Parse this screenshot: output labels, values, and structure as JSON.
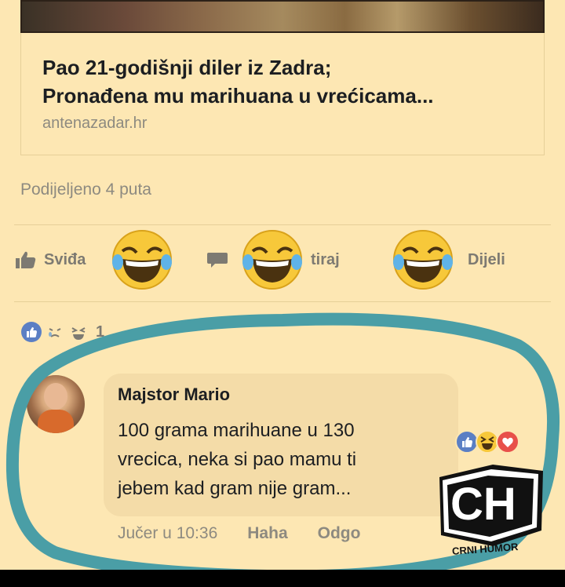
{
  "link_preview": {
    "title_line1": "Pao 21-godišnji diler iz Zadra;",
    "title_line2": "Pronađena mu marihuana u vrećicama...",
    "domain": "antenazadar.hr"
  },
  "post": {
    "shares": "Podijeljeno 4 puta"
  },
  "actions": {
    "like": "Sviđa",
    "comment": "tiraj",
    "share": "Dijeli"
  },
  "reactions": {
    "count": "1"
  },
  "comment": {
    "author": "Majstor Mario",
    "line1": "100 grama marihuane u 130",
    "line2": "vrecica, neka si pao mamu ti",
    "line3": "jebem kad gram nije gram...",
    "time": "Jučer u 10:36",
    "reaction_link": "Haha",
    "reply_link": "Odgo"
  },
  "watermark": {
    "letters": "CH",
    "text": "CRNI HUMOR"
  },
  "colors": {
    "background": "#fde7b3",
    "highlight_circle": "#4a9ea6",
    "emoji_yellow": "#f7c83a"
  }
}
